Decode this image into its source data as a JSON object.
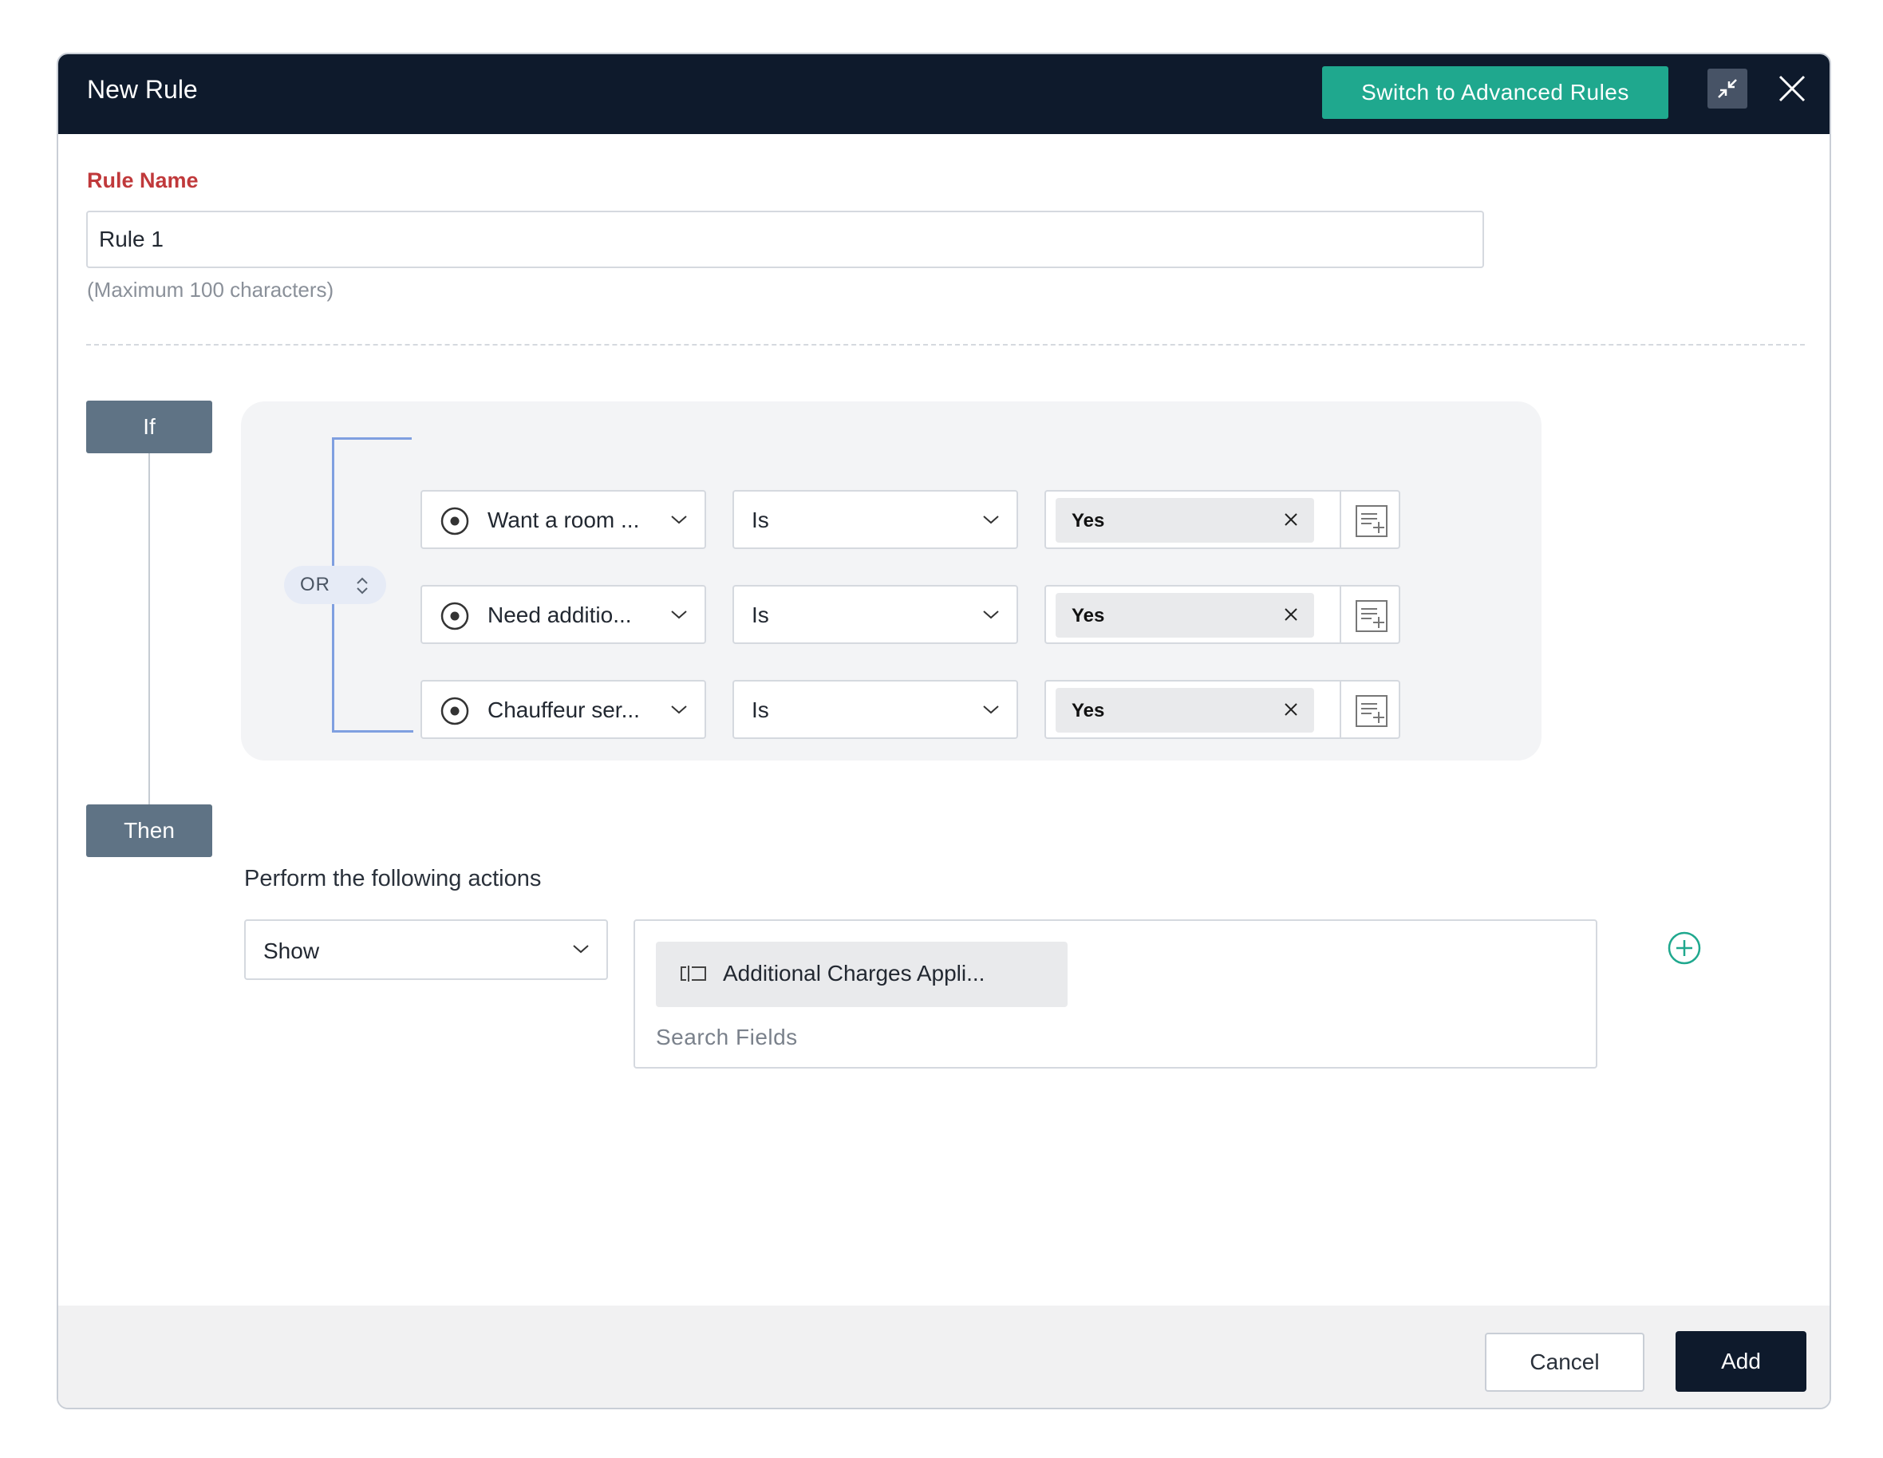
{
  "header": {
    "title": "New Rule",
    "advanced_button": "Switch to Advanced Rules",
    "minimize_icon": "minimize-arrows-icon",
    "close_icon": "close-icon"
  },
  "rule_name": {
    "label": "Rule Name",
    "value": "Rule 1",
    "hint": "(Maximum 100 characters)"
  },
  "conditions": {
    "if_label": "If",
    "connector": "OR",
    "rows": [
      {
        "field": "Want a room ...",
        "operator": "Is",
        "value": "Yes"
      },
      {
        "field": "Need additio...",
        "operator": "Is",
        "value": "Yes"
      },
      {
        "field": "Chauffeur ser...",
        "operator": "Is",
        "value": "Yes"
      }
    ]
  },
  "actions": {
    "then_label": "Then",
    "heading": "Perform the following actions",
    "action": "Show",
    "selected_field": "Additional Charges Appli...",
    "search_placeholder": "Search Fields"
  },
  "footer": {
    "cancel": "Cancel",
    "add": "Add"
  },
  "colors": {
    "header_bg": "#0e1a2c",
    "accent_green": "#1fa88e",
    "label_red": "#c0393b",
    "tag_bg": "#5f7385",
    "bracket_blue": "#7f9fe0"
  }
}
